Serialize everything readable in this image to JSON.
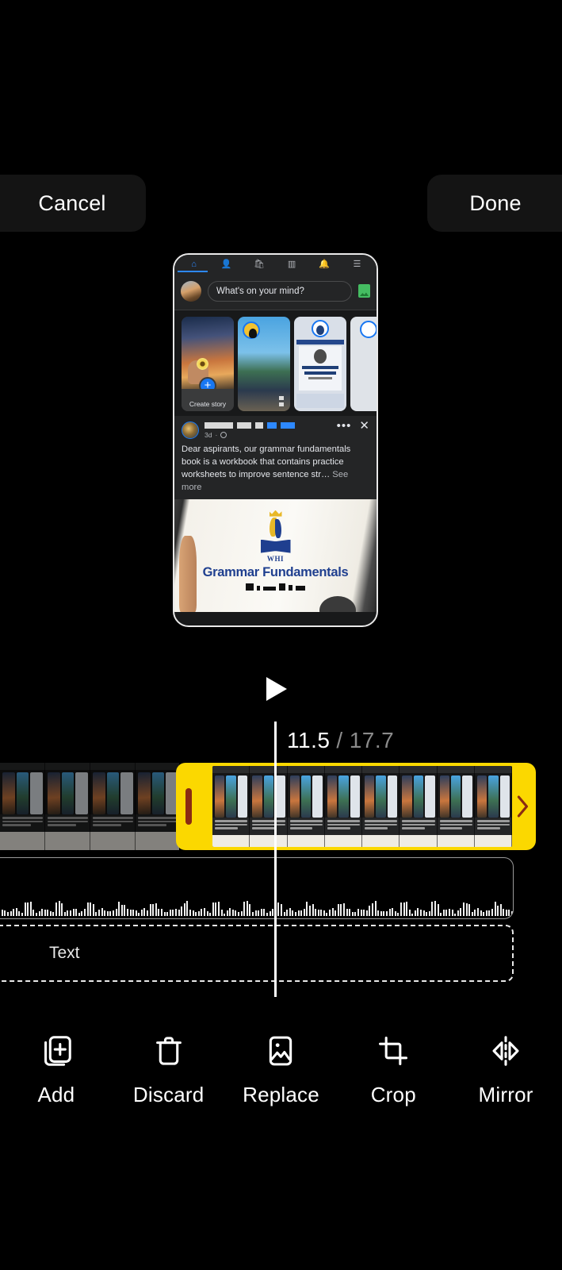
{
  "app": {
    "name": "video-trimmer",
    "accent_yellow": "#fbd800",
    "handle_color": "#8a2b12",
    "background": "#000000"
  },
  "topbar": {
    "cancel_label": "Cancel",
    "done_label": "Done"
  },
  "preview": {
    "source_app": "Facebook",
    "nav_icons": [
      "home-icon",
      "friends-icon",
      "marketplace-icon",
      "groups-icon",
      "notifications-icon",
      "menu-icon"
    ],
    "active_nav_index": 0,
    "composer": {
      "placeholder": "What's on your mind?",
      "photo_icon": "photo-icon"
    },
    "stories": [
      {
        "label": "Create story",
        "type": "create"
      },
      {
        "label": "",
        "type": "story"
      },
      {
        "label": "",
        "type": "story"
      },
      {
        "label": "",
        "type": "story"
      }
    ],
    "post": {
      "author": "",
      "time": "3d",
      "privacy_icon": "globe-icon",
      "more_icon": "more-dots-icon",
      "close_icon": "close-icon",
      "body": "Dear aspirants, our grammar fundamentals book is a workbook that contains practice worksheets to improve sentence str…",
      "see_more": "See more",
      "image": {
        "brand": "WHI",
        "title": "Grammar Fundamentals"
      }
    }
  },
  "player": {
    "play_icon": "play-icon",
    "current_time": "11.5",
    "separator": "/",
    "total_time": "17.7"
  },
  "timeline": {
    "selected_clip": true,
    "left_handle_icon": "trim-handle-icon",
    "right_handle_icon": "chevron-right-icon",
    "unselected_frames": 4,
    "selected_frames": 8
  },
  "audio_track": {
    "name": "audio-waveform-track"
  },
  "text_track": {
    "label": "Text"
  },
  "toolbar": {
    "items": [
      {
        "label": "Add",
        "icon": "add-clip-icon"
      },
      {
        "label": "Discard",
        "icon": "trash-icon"
      },
      {
        "label": "Replace",
        "icon": "image-icon"
      },
      {
        "label": "Crop",
        "icon": "crop-icon"
      },
      {
        "label": "Mirror",
        "icon": "mirror-icon"
      }
    ]
  }
}
